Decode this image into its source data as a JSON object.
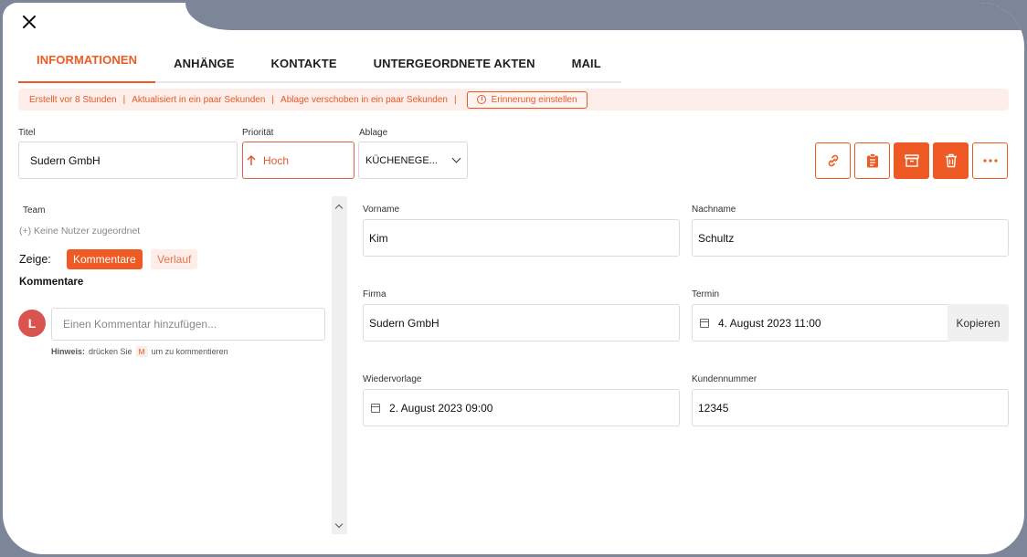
{
  "tabs": [
    {
      "label": "INFORMATIONEN"
    },
    {
      "label": "ANHÄNGE"
    },
    {
      "label": "KONTAKTE"
    },
    {
      "label": "UNTERGEORDNETE AKTEN"
    },
    {
      "label": "MAIL"
    }
  ],
  "infobar": {
    "created": "Erstellt vor 8 Stunden",
    "updated": "Aktualisiert in ein paar Sekunden",
    "moved": "Ablage verschoben in ein paar Sekunden",
    "separator": "|",
    "reminder_label": "Erinnerung einstellen"
  },
  "fields": {
    "title_label": "Titel",
    "title_value": "Sudern GmbH",
    "priority_label": "Priorität",
    "priority_value": "Hoch",
    "filing_label": "Ablage",
    "filing_value": "KÜCHENEGE..."
  },
  "left": {
    "team_label": "Team",
    "no_users": "(+) Keine Nutzer zugeordnet",
    "show_label": "Zeige:",
    "show_comments": "Kommentare",
    "show_history": "Verlauf",
    "comments_title": "Kommentare",
    "avatar_letter": "L",
    "comment_placeholder": "Einen Kommentar hinzufügen...",
    "hint_bold": "Hinweis:",
    "hint_pre": "drücken Sie",
    "hint_key": "M",
    "hint_post": "um zu kommentieren"
  },
  "form": {
    "vorname_label": "Vorname",
    "vorname_value": "Kim",
    "nachname_label": "Nachname",
    "nachname_value": "Schultz",
    "firma_label": "Firma",
    "firma_value": "Sudern GmbH",
    "termin_label": "Termin",
    "termin_value": "4. August 2023 11:00",
    "copy_label": "Kopieren",
    "wiedervorlage_label": "Wiedervorlage",
    "wiedervorlage_value": "2. August 2023 09:00",
    "kundennummer_label": "Kundennummer",
    "kundennummer_value": "12345"
  },
  "colors": {
    "accent": "#ef5a24",
    "accent_light": "#fdeee9",
    "backdrop": "#7d8598"
  },
  "icons": {
    "close": "close-icon",
    "link": "link-icon",
    "clipboard": "clipboard-icon",
    "archive": "archive-icon",
    "trash": "trash-icon",
    "more": "more-dots-icon"
  }
}
